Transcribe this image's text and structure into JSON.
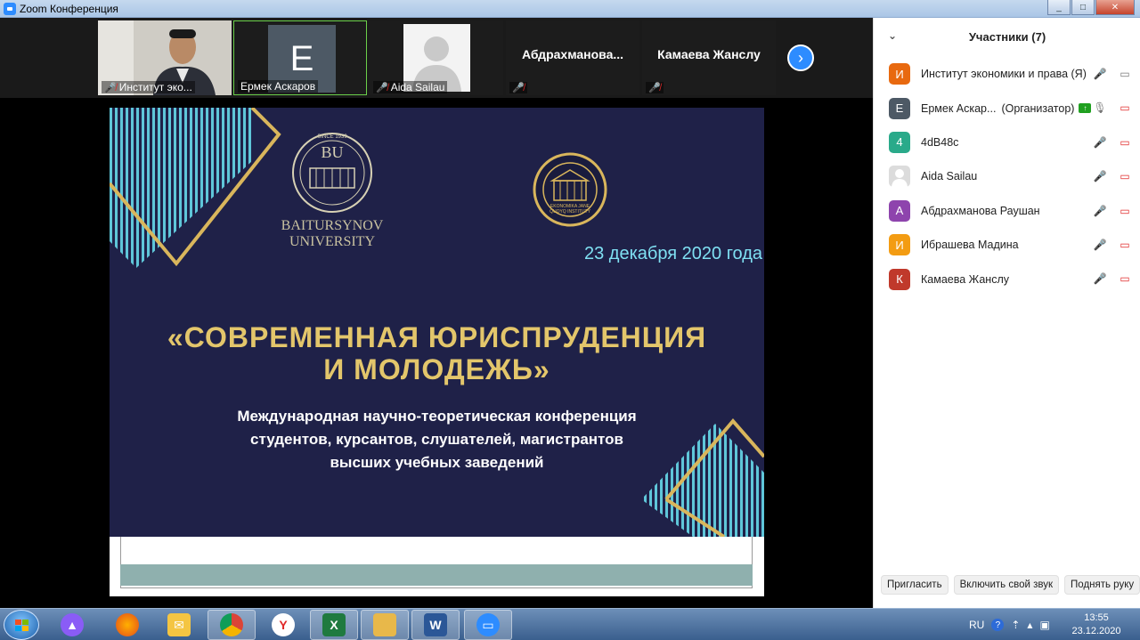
{
  "window": {
    "title": "Zoom Конференция",
    "minimize_label": "_",
    "maximize_label": "□",
    "close_label": "✕"
  },
  "video_strip": {
    "tiles": [
      {
        "name": "Институт эко..."
      },
      {
        "name": "Ермек Аскаров",
        "initial": "E"
      },
      {
        "name": "Aida Sailau"
      },
      {
        "name": "Абдрахманова..."
      },
      {
        "name": "Камаева Жанслу"
      }
    ],
    "next_label": "›"
  },
  "slide": {
    "bu_caption_line1": "BAITURSYNOV",
    "bu_caption_line2": "UNIVERSITY",
    "bu_monogram": "BU",
    "bu_since": "SINCE 1939",
    "emblem_text": "EKONOMIKA JANE QUQYQ INSTITUTY",
    "date": "23 декабря 2020 года",
    "heading_line1": "«СОВРЕМЕННАЯ ЮРИСПРУДЕНЦИЯ",
    "heading_line2": "И МОЛОДЕЖЬ»",
    "sub_line1": "Международная научно-теоретическая конференция",
    "sub_line2": "студентов, курсантов, слушателей, магистрантов",
    "sub_line3": "высших учебных заведений"
  },
  "participants": {
    "title": "Участники (7)",
    "items": [
      {
        "initial": "И",
        "name": "Институт экономики и права (Я)",
        "color": "#e8690f",
        "role": ""
      },
      {
        "initial": "E",
        "name": "Ермек Аскар...",
        "color": "#4d5965",
        "role": "(Организатор)"
      },
      {
        "initial": "4",
        "name": "4dB48c",
        "color": "#2aaa8a",
        "role": ""
      },
      {
        "initial": "",
        "name": "Aida Sailau",
        "color": "#dcdcdc",
        "role": ""
      },
      {
        "initial": "А",
        "name": "Абдрахманова Раушан",
        "color": "#8e44ad",
        "role": ""
      },
      {
        "initial": "И",
        "name": "Ибрашева Мадина",
        "color": "#f39c12",
        "role": ""
      },
      {
        "initial": "К",
        "name": "Камаева Жанслу",
        "color": "#c0392b",
        "role": ""
      }
    ],
    "buttons": {
      "invite": "Пригласить",
      "unmute": "Включить свой звук",
      "raise_hand": "Поднять руку"
    }
  },
  "taskbar": {
    "lang": "RU",
    "time": "13:55",
    "date": "23.12.2020"
  }
}
